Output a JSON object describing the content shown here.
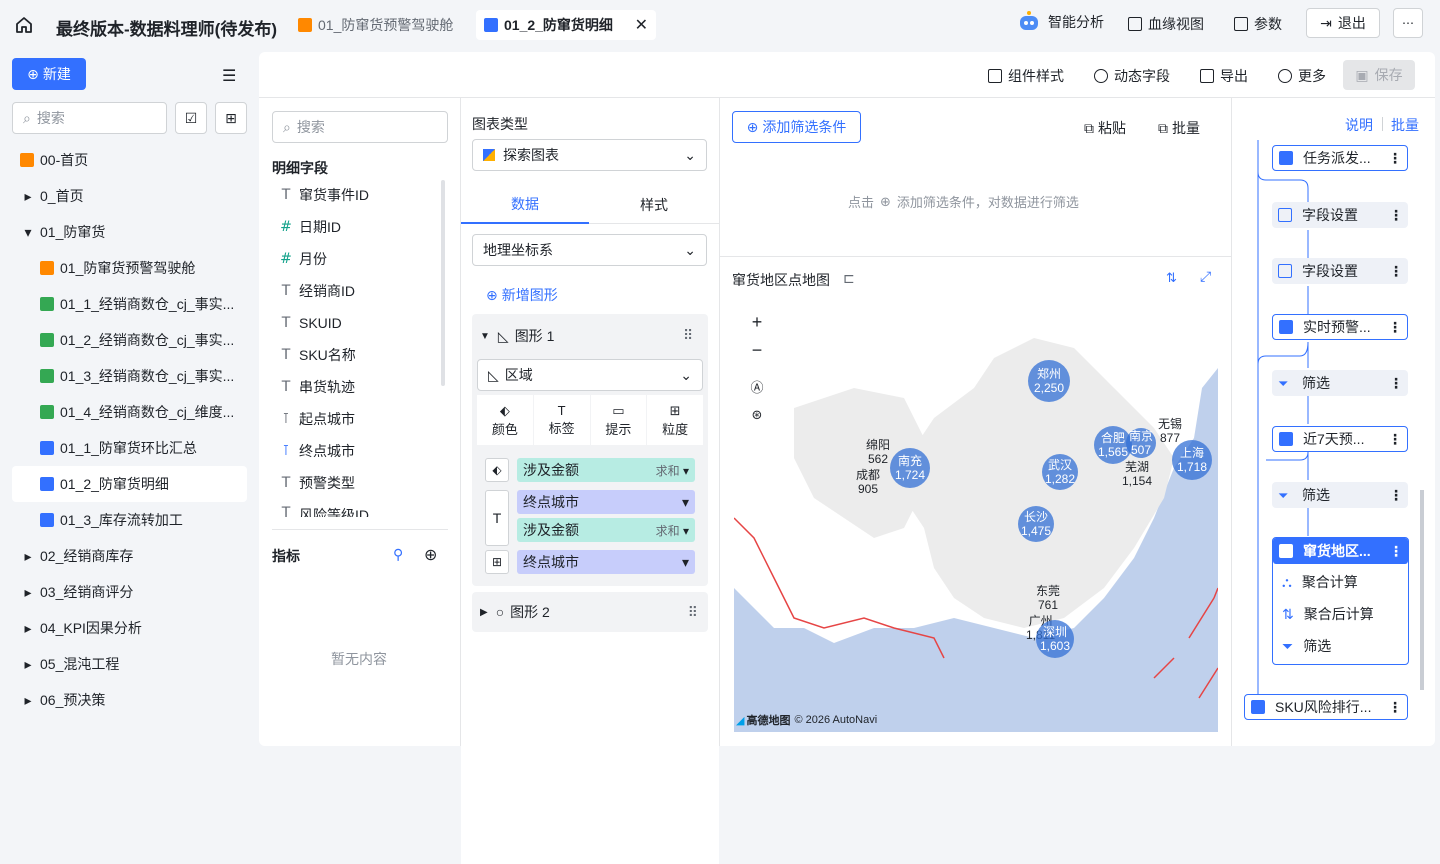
{
  "app": {
    "title": "最终版本-数据料理师(待发布)"
  },
  "tabs": [
    {
      "label": "01_防窜货预警驾驶舱"
    },
    {
      "label": "01_2_防窜货明细"
    }
  ],
  "header_actions": {
    "ai": "智能分析",
    "lineage": "血缘视图",
    "params": "参数",
    "logout": "退出"
  },
  "sidebar": {
    "new_label": "新建",
    "search_placeholder": "搜索",
    "items": [
      {
        "label": "00-首页"
      },
      {
        "label": "0_首页"
      },
      {
        "label": "01_防窜货"
      },
      {
        "label": "01_防窜货预警驾驶舱"
      },
      {
        "label": "01_1_经销商数仓_cj_事实..."
      },
      {
        "label": "01_2_经销商数仓_cj_事实..."
      },
      {
        "label": "01_3_经销商数仓_cj_事实..."
      },
      {
        "label": "01_4_经销商数仓_cj_维度..."
      },
      {
        "label": "01_1_防窜货环比汇总"
      },
      {
        "label": "01_2_防窜货明细"
      },
      {
        "label": "01_3_库存流转加工"
      },
      {
        "label": "02_经销商库存"
      },
      {
        "label": "03_经销商评分"
      },
      {
        "label": "04_KPI因果分析"
      },
      {
        "label": "05_混沌工程"
      },
      {
        "label": "06_预决策"
      }
    ]
  },
  "toolbar": {
    "style": "组件样式",
    "dynamic": "动态字段",
    "export": "导出",
    "more": "更多",
    "save": "保存"
  },
  "fields": {
    "search_placeholder": "搜索",
    "detail_title": "明细字段",
    "items": [
      {
        "label": "窜货事件ID"
      },
      {
        "label": "日期ID"
      },
      {
        "label": "月份"
      },
      {
        "label": "经销商ID"
      },
      {
        "label": "SKUID"
      },
      {
        "label": "SKU名称"
      },
      {
        "label": "串货轨迹"
      },
      {
        "label": "起点城市"
      },
      {
        "label": "终点城市"
      },
      {
        "label": "预警类型"
      },
      {
        "label": "风险等级ID"
      }
    ],
    "metrics_title": "指标",
    "empty": "暂无内容"
  },
  "config": {
    "chart_type_label": "图表类型",
    "chart_type_value": "探索图表",
    "tab_data": "数据",
    "tab_style": "样式",
    "coord": "地理坐标系",
    "add_shape": "新增图形",
    "shape1": "图形 1",
    "shape1_type": "区域",
    "marks": [
      "颜色",
      "标签",
      "提示",
      "粒度"
    ],
    "pills": [
      {
        "label": "涉及金额",
        "agg": "求和"
      },
      {
        "label": "终点城市",
        "agg": ""
      },
      {
        "label": "涉及金额",
        "agg": "求和"
      },
      {
        "label": "终点城市",
        "agg": ""
      }
    ],
    "shape2": "图形 2"
  },
  "filter": {
    "add": "添加筛选条件",
    "paste": "粘贴",
    "batch": "批量",
    "hint_pre": "点击",
    "hint_post": "添加筛选条件，对数据进行筛选"
  },
  "map": {
    "title": "窜货地区点地图",
    "attribution": "© 2026 AutoNavi",
    "brand": "高德地图",
    "points": [
      {
        "city": "郑州",
        "value": "2,250"
      },
      {
        "city": "绵阳",
        "value": "562"
      },
      {
        "city": "南充",
        "value": "1,724"
      },
      {
        "city": "成都",
        "value": "905"
      },
      {
        "city": "合肥",
        "value": "1,565"
      },
      {
        "city": "南京",
        "value": "507"
      },
      {
        "city": "无锡",
        "value": "877"
      },
      {
        "city": "上海",
        "value": "1,718"
      },
      {
        "city": "芜湖",
        "value": "1,154"
      },
      {
        "city": "武汉",
        "value": "1,282"
      },
      {
        "city": "长沙",
        "value": "1,475"
      },
      {
        "city": "东莞",
        "value": "761"
      },
      {
        "city": "广州",
        "value": "1,811"
      },
      {
        "city": "深圳",
        "value": "1,603"
      }
    ]
  },
  "flow": {
    "explain": "说明",
    "batch": "批量",
    "nodes": [
      {
        "label": "任务派发..."
      },
      {
        "label": "字段设置"
      },
      {
        "label": "字段设置"
      },
      {
        "label": "实时预警..."
      },
      {
        "label": "筛选"
      },
      {
        "label": "近7天预..."
      },
      {
        "label": "筛选"
      },
      {
        "label": "窜货地区..."
      },
      {
        "label": "聚合计算"
      },
      {
        "label": "聚合后计算"
      },
      {
        "label": "筛选"
      },
      {
        "label": "SKU风险排行..."
      }
    ]
  }
}
